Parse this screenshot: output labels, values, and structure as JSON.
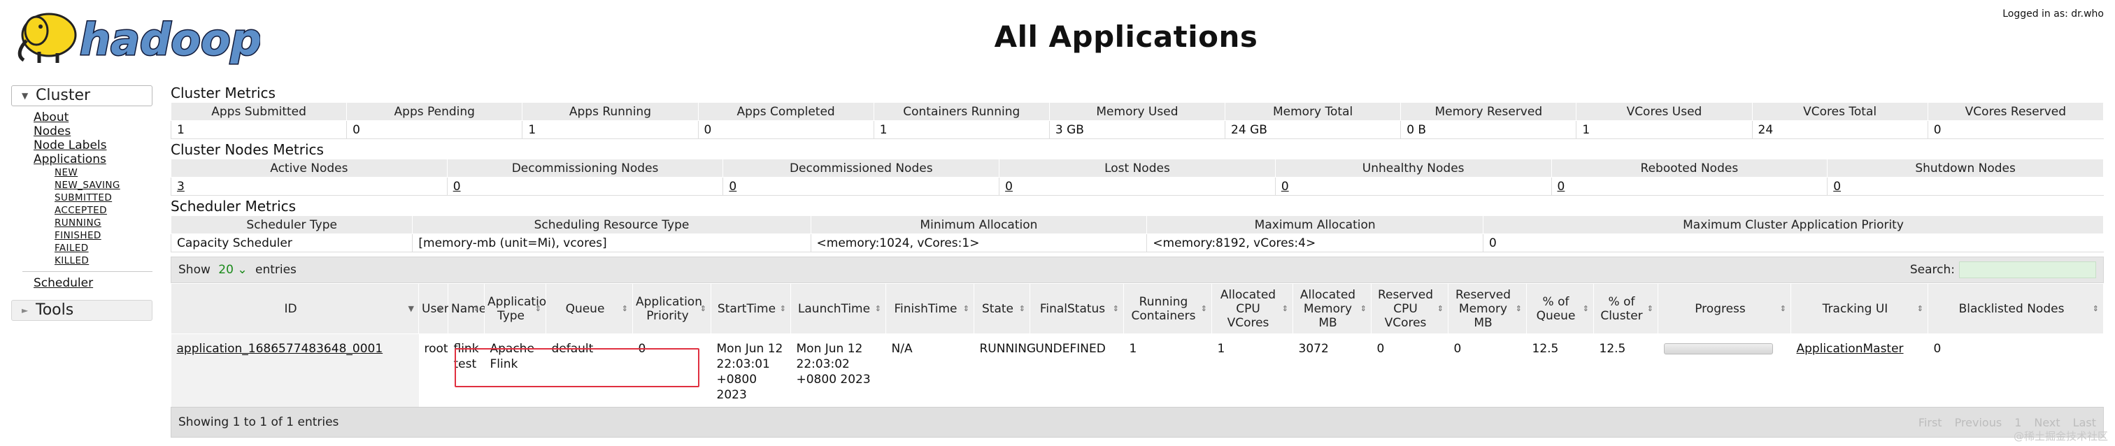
{
  "header": {
    "logo_text": "hadoop",
    "title": "All Applications",
    "logged_in": "Logged in as: dr.who"
  },
  "sidebar": {
    "cluster_label": "Cluster",
    "links": [
      "About",
      "Nodes",
      "Node Labels",
      "Applications"
    ],
    "app_states": [
      "NEW",
      "NEW_SAVING",
      "SUBMITTED",
      "ACCEPTED",
      "RUNNING",
      "FINISHED",
      "FAILED",
      "KILLED"
    ],
    "scheduler": "Scheduler",
    "tools_label": "Tools"
  },
  "cluster_metrics": {
    "title": "Cluster Metrics",
    "headers": [
      "Apps Submitted",
      "Apps Pending",
      "Apps Running",
      "Apps Completed",
      "Containers Running",
      "Memory Used",
      "Memory Total",
      "Memory Reserved",
      "VCores Used",
      "VCores Total",
      "VCores Reserved"
    ],
    "values": [
      "1",
      "0",
      "1",
      "0",
      "1",
      "3 GB",
      "24 GB",
      "0 B",
      "1",
      "24",
      "0"
    ]
  },
  "node_metrics": {
    "title": "Cluster Nodes Metrics",
    "headers": [
      "Active Nodes",
      "Decommissioning Nodes",
      "Decommissioned Nodes",
      "Lost Nodes",
      "Unhealthy Nodes",
      "Rebooted Nodes",
      "Shutdown Nodes"
    ],
    "values": [
      "3",
      "0",
      "0",
      "0",
      "0",
      "0",
      "0"
    ]
  },
  "scheduler_metrics": {
    "title": "Scheduler Metrics",
    "headers": [
      "Scheduler Type",
      "Scheduling Resource Type",
      "Minimum Allocation",
      "Maximum Allocation",
      "Maximum Cluster Application Priority"
    ],
    "values": [
      "Capacity Scheduler",
      "[memory-mb (unit=Mi), vcores]",
      "<memory:1024, vCores:1>",
      "<memory:8192, vCores:4>",
      "0"
    ]
  },
  "apps_table": {
    "show_label": "Show",
    "page_size": "20",
    "entries_label": "entries",
    "search_label": "Search:",
    "columns": [
      "ID",
      "User",
      "Name",
      "Application Type",
      "Queue",
      "Application Priority",
      "StartTime",
      "LaunchTime",
      "FinishTime",
      "State",
      "FinalStatus",
      "Running Containers",
      "Allocated CPU VCores",
      "Allocated Memory MB",
      "Reserved CPU VCores",
      "Reserved Memory MB",
      "% of Queue",
      "% of Cluster",
      "Progress",
      "Tracking UI",
      "Blacklisted Nodes"
    ],
    "row": {
      "id": "application_1686577483648_0001",
      "user": "root",
      "name": "flink-test",
      "type": "Apache Flink",
      "queue": "default",
      "priority": "0",
      "start_time": "Mon Jun 12 22:03:01 +0800 2023",
      "launch_time": "Mon Jun 12 22:03:02 +0800 2023",
      "finish_time": "N/A",
      "state": "RUNNING",
      "final_status": "UNDEFINED",
      "running_containers": "1",
      "alloc_vcores": "1",
      "alloc_memory": "3072",
      "reserved_vcores": "0",
      "reserved_memory": "0",
      "pct_queue": "12.5",
      "pct_cluster": "12.5",
      "progress": 0,
      "tracking_ui": "ApplicationMaster",
      "blacklisted": "0"
    },
    "footer": "Showing 1 to 1 of 1 entries",
    "pager": [
      "First",
      "Previous",
      "1",
      "Next",
      "Last"
    ]
  },
  "watermark": "@稀土掘金技术社区",
  "colors": {
    "highlight": "#e03040",
    "search_bg": "#dff2df",
    "header_bg": "#eaeaea"
  }
}
